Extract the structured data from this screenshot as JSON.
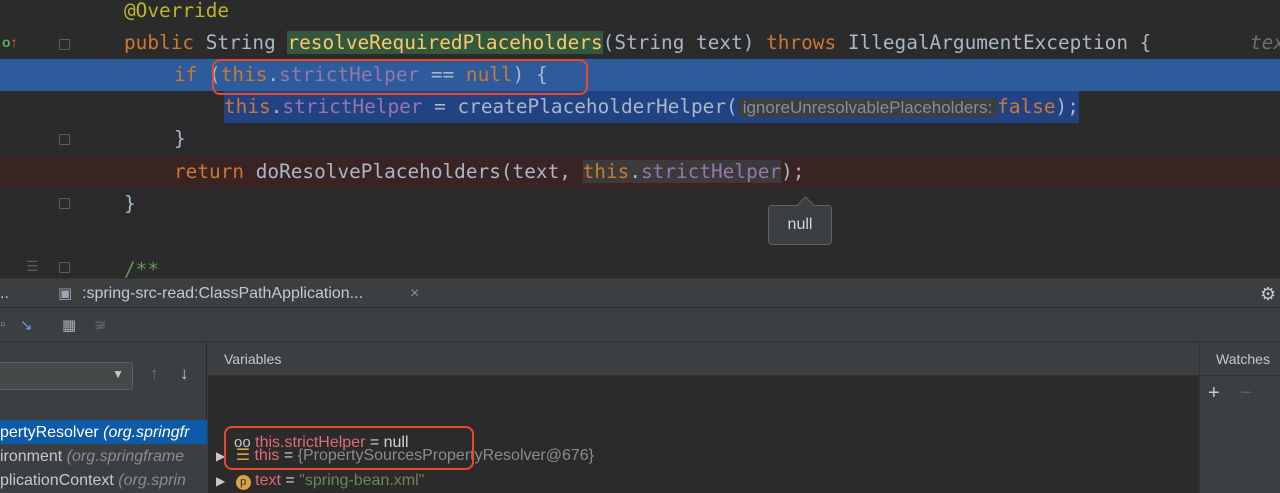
{
  "editor": {
    "line0": {
      "annotation": "@Override"
    },
    "line1": {
      "kw_public": "public",
      "ret_type": " String ",
      "method": "resolveRequiredPlaceholders",
      "params": "(String text) ",
      "kw_throws": "throws",
      "exc": " IllegalArgumentException {",
      "hint_tail": "tex"
    },
    "line2": {
      "kw_if": "if",
      "open": " (",
      "kw_this": "this",
      "dot": ".",
      "field": "strictHelper",
      "eq": " == ",
      "kw_null": "null",
      "close": ") {"
    },
    "line3": {
      "kw_this": "this",
      "dot": ".",
      "field": "strictHelper",
      "assign": " = createPlaceholderHelper(",
      "hint_label": "ignoreUnresolvablePlaceholders:",
      "kw_false": "false",
      "end": ");"
    },
    "line4": {
      "brace": "}"
    },
    "line5": {
      "kw_return": "return",
      "call": " doResolvePlaceholders(text, ",
      "kw_this": "this",
      "dot": ".",
      "field": "strictHelper",
      "end": ");"
    },
    "line6": {
      "brace": "}"
    },
    "line7": {
      "comment": "/**"
    },
    "tooltip": "null"
  },
  "panel": {
    "tab_left": "..",
    "tab_session": ":spring-src-read:ClassPathApplication...",
    "tab_close": "×",
    "variables_header": "Variables",
    "watches_header": "Watches",
    "watches_add": "+",
    "watches_remove": "−",
    "variables": [
      {
        "icon": "field-list-icon",
        "name": "this",
        "eq": " = ",
        "value": "{PropertySourcesPropertyResolver@676}"
      },
      {
        "icon": "parameter-icon",
        "name": "text",
        "eq": " = ",
        "value": "\"spring-bean.xml\""
      },
      {
        "icon": "watch-glasses-icon",
        "name": "this.strictHelper",
        "eq": " = ",
        "value": "null"
      }
    ],
    "frames": [
      {
        "method": "pertyResolver",
        "pkg": " (org.springfr"
      },
      {
        "method": "ironment",
        "pkg": " (org.springframe"
      },
      {
        "method": "plicationContext",
        "pkg": " (org.sprin"
      }
    ]
  },
  "colors": {
    "keyword": "#cc7832",
    "field": "#9876aa",
    "method": "#ffc66d",
    "annotation": "#bbb529",
    "highlight_blue": "#2d5b9c",
    "callout_red": "#e8492d"
  }
}
